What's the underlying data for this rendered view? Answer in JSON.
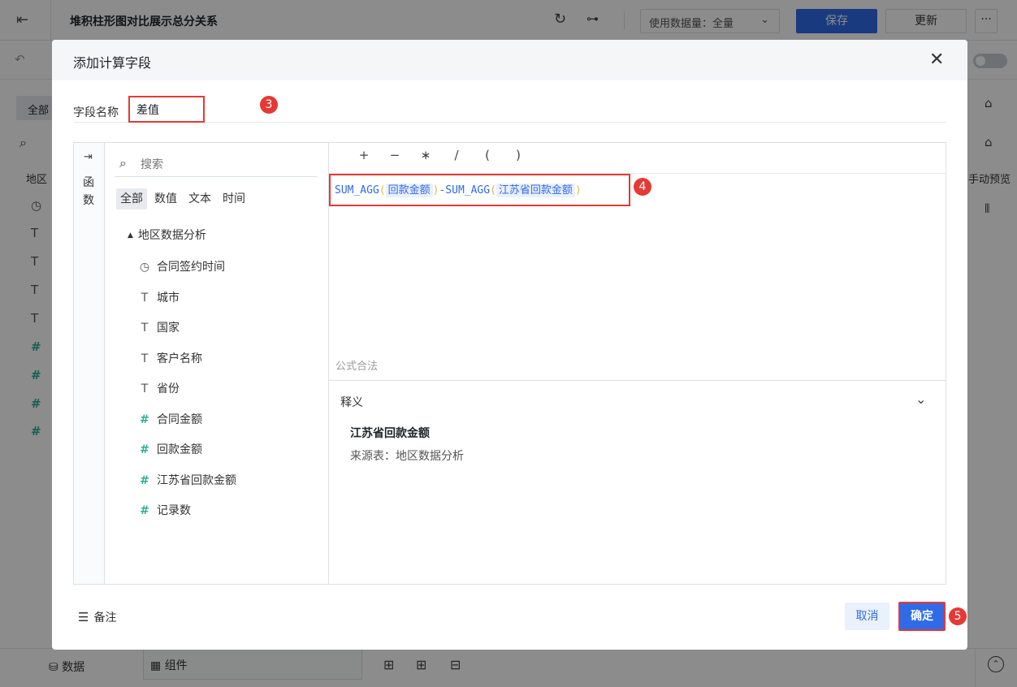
{
  "app": {
    "title": "堆积柱形图对比展示总分关系",
    "data_volume": "使用数据量：全量",
    "save_label": "保存",
    "update_label": "更新",
    "more_label": "···"
  },
  "left_panel": {
    "all_label": "全部",
    "group_label": "地区"
  },
  "right_panel": {
    "preview_label": "手动预览"
  },
  "bottom_bar": {
    "data_label": "数据",
    "component_label": "组件"
  },
  "modal": {
    "title": "添加计算字段",
    "field_name_label": "字段名称",
    "field_name_value": "差值",
    "function_label": "函数",
    "search_placeholder": "搜索",
    "tabs": [
      "全部",
      "数值",
      "文本",
      "时间"
    ],
    "tree_group": "地区数据分析",
    "fields": [
      {
        "name": "合同签约时间",
        "icon": "clock-icon"
      },
      {
        "name": "城市",
        "icon": "text-type-icon"
      },
      {
        "name": "国家",
        "icon": "text-type-icon"
      },
      {
        "name": "客户名称",
        "icon": "text-type-icon"
      },
      {
        "name": "省份",
        "icon": "text-type-icon"
      },
      {
        "name": "合同金额",
        "icon": "number-type-icon"
      },
      {
        "name": "回款金额",
        "icon": "number-type-icon"
      },
      {
        "name": "江苏省回款金额",
        "icon": "number-type-icon"
      },
      {
        "name": "记录数",
        "icon": "count-type-icon"
      }
    ],
    "operators": [
      "+",
      "−",
      "∗",
      "/",
      "(",
      ")"
    ],
    "formula": {
      "fn1": "SUM_AGG",
      "arg1": "回款金额",
      "minus": "-",
      "fn2": "SUM_AGG",
      "arg2": "江苏省回款金额"
    },
    "formula_status": "公式合法",
    "explain_title": "释义",
    "explain_name": "江苏省回款金额",
    "explain_source": "来源表：地区数据分析",
    "note_label": "备注",
    "cancel_label": "取消",
    "confirm_label": "确定"
  },
  "annotations": [
    "3",
    "4",
    "5"
  ],
  "colors": {
    "accent": "#2f6be6",
    "highlight_border": "#e53935",
    "number_field": "#2fae96"
  }
}
